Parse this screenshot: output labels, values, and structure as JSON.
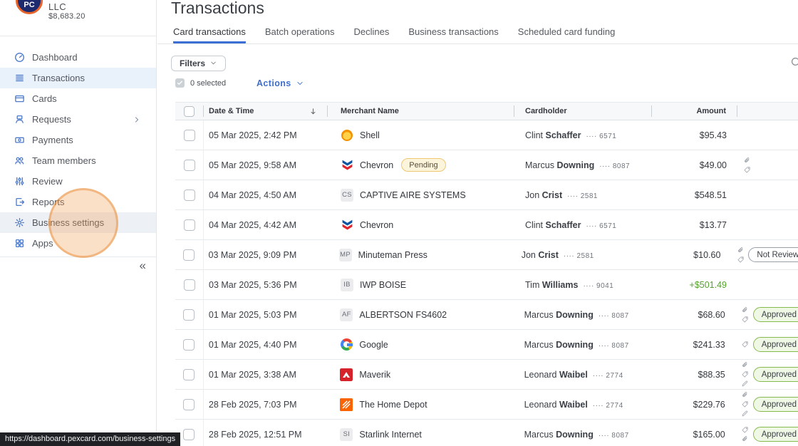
{
  "sidebar": {
    "company": {
      "name_line": "LLC",
      "balance": "$8,683.20",
      "logo_text": "PC"
    },
    "items": [
      {
        "label": "Dashboard",
        "icon": "dashboard-icon"
      },
      {
        "label": "Transactions",
        "icon": "transactions-icon",
        "selected": true
      },
      {
        "label": "Cards",
        "icon": "cards-icon"
      },
      {
        "label": "Requests",
        "icon": "requests-icon",
        "has_chevron": true
      },
      {
        "label": "Payments",
        "icon": "payments-icon"
      },
      {
        "label": "Team members",
        "icon": "team-members-icon"
      },
      {
        "label": "Review",
        "icon": "review-icon"
      },
      {
        "label": "Reports",
        "icon": "reports-icon"
      },
      {
        "label": "Business settings",
        "icon": "gear-icon",
        "highlighted": true,
        "click_indicator": true
      },
      {
        "label": "Apps",
        "icon": "apps-icon"
      }
    ],
    "collapse_glyph": "«"
  },
  "header": {
    "title": "Transactions",
    "tabs": [
      {
        "label": "Card transactions",
        "active": true
      },
      {
        "label": "Batch operations"
      },
      {
        "label": "Declines"
      },
      {
        "label": "Business transactions"
      },
      {
        "label": "Scheduled card funding"
      }
    ],
    "search_icon": "magnifier-icon"
  },
  "toolbar": {
    "filters_label": "Filters",
    "selected_count": "0 selected",
    "actions_label": "Actions"
  },
  "table": {
    "columns": [
      "Date & Time",
      "Merchant Name",
      "Cardholder",
      "Amount"
    ],
    "sort_column": "Date & Time",
    "sort_direction": "descending",
    "rows": [
      {
        "date": "05 Mar 2025, 2:42 PM",
        "merchant": "Shell",
        "logo": {
          "type": "shell"
        },
        "cardholder_first": "Clint",
        "cardholder_last": "Schaffer",
        "card_last4": "6571",
        "amount": "$95.43",
        "amount_positive": false,
        "icons": [],
        "badge": null,
        "status": null
      },
      {
        "date": "05 Mar 2025, 9:58 AM",
        "merchant": "Chevron",
        "logo": {
          "type": "chevron"
        },
        "cardholder_first": "Marcus",
        "cardholder_last": "Downing",
        "card_last4": "8087",
        "amount": "$49.00",
        "amount_positive": false,
        "icons": [
          "paperclip",
          "tag"
        ],
        "badge": "Pending",
        "status": null
      },
      {
        "date": "04 Mar 2025, 4:50 AM",
        "merchant": "CAPTIVE AIRE SYSTEMS",
        "logo": {
          "type": "initials",
          "text": "CS"
        },
        "cardholder_first": "Jon",
        "cardholder_last": "Crist",
        "card_last4": "2581",
        "amount": "$548.51",
        "amount_positive": false,
        "icons": [],
        "badge": null,
        "status": null
      },
      {
        "date": "04 Mar 2025, 4:42 AM",
        "merchant": "Chevron",
        "logo": {
          "type": "chevron"
        },
        "cardholder_first": "Clint",
        "cardholder_last": "Schaffer",
        "card_last4": "6571",
        "amount": "$13.77",
        "amount_positive": false,
        "icons": [],
        "badge": null,
        "status": null
      },
      {
        "date": "03 Mar 2025, 9:09 PM",
        "merchant": "Minuteman Press",
        "logo": {
          "type": "initials",
          "text": "MP"
        },
        "cardholder_first": "Jon",
        "cardholder_last": "Crist",
        "card_last4": "2581",
        "amount": "$10.60",
        "amount_positive": false,
        "icons": [
          "paperclip",
          "tag"
        ],
        "badge": null,
        "status": {
          "label": "Not Reviewed",
          "variant": "neutral",
          "has_chevron": false
        }
      },
      {
        "date": "03 Mar 2025, 5:36 PM",
        "merchant": "IWP BOISE",
        "logo": {
          "type": "initials",
          "text": "IB"
        },
        "cardholder_first": "Tim",
        "cardholder_last": "Williams",
        "card_last4": "9041",
        "amount": "+$501.49",
        "amount_positive": true,
        "icons": [],
        "badge": null,
        "status": null
      },
      {
        "date": "01 Mar 2025, 5:03 PM",
        "merchant": "ALBERTSON FS4602",
        "logo": {
          "type": "initials",
          "text": "AF"
        },
        "cardholder_first": "Marcus",
        "cardholder_last": "Downing",
        "card_last4": "8087",
        "amount": "$68.60",
        "amount_positive": false,
        "icons": [
          "paperclip",
          "tag"
        ],
        "badge": null,
        "status": {
          "label": "Approved",
          "variant": "approved",
          "has_chevron": true
        }
      },
      {
        "date": "01 Mar 2025, 4:40 PM",
        "merchant": "Google",
        "logo": {
          "type": "google"
        },
        "cardholder_first": "Marcus",
        "cardholder_last": "Downing",
        "card_last4": "8087",
        "amount": "$241.33",
        "amount_positive": false,
        "icons": [
          "tag"
        ],
        "badge": null,
        "status": {
          "label": "Approved",
          "variant": "approved",
          "has_chevron": true
        }
      },
      {
        "date": "01 Mar 2025, 3:38 AM",
        "merchant": "Maverik",
        "logo": {
          "type": "maverik"
        },
        "cardholder_first": "Leonard",
        "cardholder_last": "Waibel",
        "card_last4": "2774",
        "amount": "$88.35",
        "amount_positive": false,
        "icons": [
          "paperclip",
          "tag",
          "pencil"
        ],
        "badge": null,
        "status": {
          "label": "Approved",
          "variant": "approved",
          "has_chevron": true
        }
      },
      {
        "date": "28 Feb 2025, 7:03 PM",
        "merchant": "The Home Depot",
        "logo": {
          "type": "homedepot"
        },
        "cardholder_first": "Leonard",
        "cardholder_last": "Waibel",
        "card_last4": "2774",
        "amount": "$229.76",
        "amount_positive": false,
        "icons": [
          "paperclip",
          "tag",
          "pencil"
        ],
        "badge": null,
        "status": {
          "label": "Approved",
          "variant": "approved",
          "has_chevron": true
        }
      },
      {
        "date": "28 Feb 2025, 12:51 PM",
        "merchant": "Starlink Internet",
        "logo": {
          "type": "initials",
          "text": "SI"
        },
        "cardholder_first": "Marcus",
        "cardholder_last": "Downing",
        "card_last4": "8087",
        "amount": "$165.00",
        "amount_positive": false,
        "icons": [
          "tag",
          "paperclip"
        ],
        "badge": null,
        "status": {
          "label": "Approved",
          "variant": "approved",
          "has_chevron": true
        }
      }
    ],
    "card_last4_prefix": "····"
  },
  "statusbar": {
    "url": "https://dashboard.pexcard.com/business-settings"
  },
  "colors": {
    "accent_blue": "#3e6fc9",
    "tab_underline_blue": "#3b6fd4",
    "sidebar_selected_bg": "#e9f1fb",
    "approved_green_border": "#85ba4f",
    "approved_green_bg": "#eff7e5",
    "pending_border": "#edc772",
    "pending_bg": "#fdf4dc",
    "positive_amount_green": "#55a02e",
    "click_indicator_orange": "#ef9b4a"
  }
}
